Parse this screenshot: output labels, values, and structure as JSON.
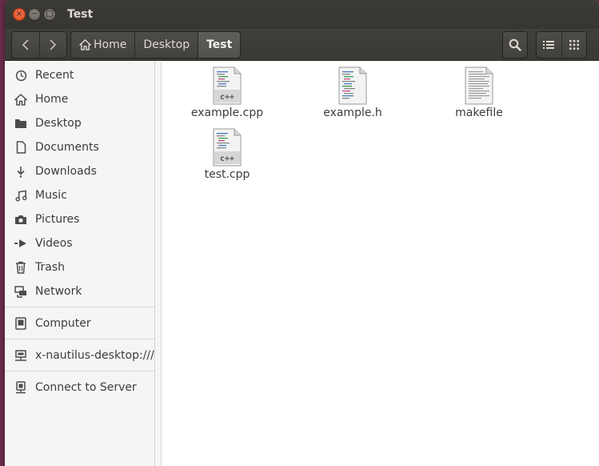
{
  "window": {
    "title": "Test",
    "controls": {
      "close": "×",
      "minimize": "−",
      "maximize": "□"
    }
  },
  "toolbar": {
    "back_icon": "chevron-left",
    "forward_icon": "chevron-right",
    "breadcrumbs": [
      {
        "label": "Home",
        "icon": "home-icon"
      },
      {
        "label": "Desktop"
      },
      {
        "label": "Test",
        "active": true
      }
    ],
    "search_icon": "search-icon",
    "list_view_icon": "list-view-icon",
    "grid_view_icon": "grid-view-icon"
  },
  "sidebar": {
    "items": [
      {
        "label": "Recent",
        "icon": "clock-icon"
      },
      {
        "label": "Home",
        "icon": "home-icon"
      },
      {
        "label": "Desktop",
        "icon": "folder-icon"
      },
      {
        "label": "Documents",
        "icon": "document-icon"
      },
      {
        "label": "Downloads",
        "icon": "download-icon"
      },
      {
        "label": "Music",
        "icon": "music-icon"
      },
      {
        "label": "Pictures",
        "icon": "camera-icon"
      },
      {
        "label": "Videos",
        "icon": "video-icon"
      },
      {
        "label": "Trash",
        "icon": "trash-icon"
      },
      {
        "label": "Network",
        "icon": "network-icon"
      }
    ],
    "devices": [
      {
        "label": "Computer",
        "icon": "computer-icon"
      }
    ],
    "bookmarks": [
      {
        "label": "x-nautilus-desktop:///",
        "icon": "network-drive-icon"
      }
    ],
    "connect": {
      "label": "Connect to Server",
      "icon": "server-icon"
    }
  },
  "files": [
    {
      "name": "example.cpp",
      "type": "cpp"
    },
    {
      "name": "example.h",
      "type": "header"
    },
    {
      "name": "makefile",
      "type": "text"
    },
    {
      "name": "test.cpp",
      "type": "cpp"
    }
  ],
  "colors": {
    "titlebar": "#3c3b37",
    "close_button": "#df4a16",
    "sidebar_bg": "#f5f5f4",
    "content_bg": "#ffffff"
  }
}
